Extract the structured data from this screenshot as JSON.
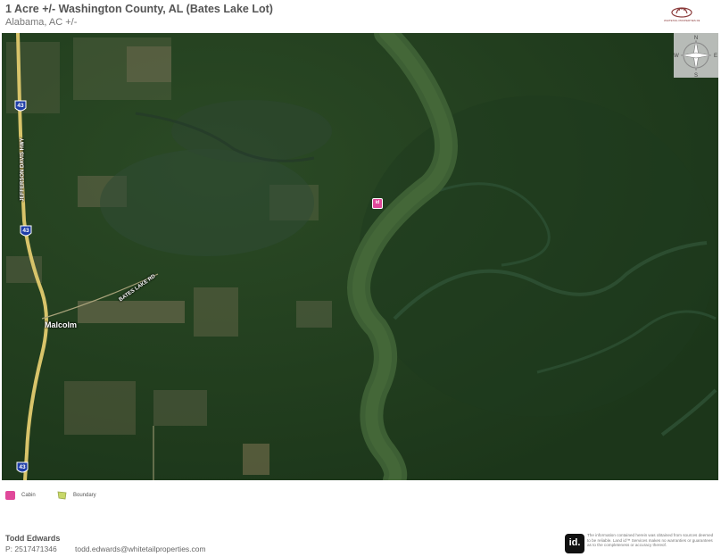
{
  "header": {
    "title": "1 Acre +/- Washington County, AL (Bates Lake Lot)",
    "subtitle": "Alabama,  AC +/-",
    "brand_logo_text": "WHITETAIL PROPERTIES REAL ESTATE"
  },
  "map": {
    "imagery": "satellite",
    "labels": {
      "town": "Malcolm",
      "road_1": "JEFFERSON DAVIS HWY",
      "road_2": "BATES LAKE RD"
    },
    "route_shields": [
      "43",
      "43",
      "43"
    ],
    "marker": {
      "text": "id",
      "label": "Cabin",
      "icon": "cabin-icon",
      "color": "#e0499a"
    },
    "compass": {
      "north": "N",
      "south": "S",
      "east": "E",
      "west": "W"
    },
    "colors": {
      "forest": "#1f3d1c",
      "river": "#3d5f34",
      "highway": "#d8c46a"
    }
  },
  "legend": {
    "items": [
      {
        "label": "Cabin",
        "icon": "cabin-icon",
        "color": "#e0499a"
      },
      {
        "label": "Boundary",
        "icon": "boundary-icon",
        "color": "#c8d86a"
      }
    ]
  },
  "contact": {
    "name": "Todd Edwards",
    "phone": "P: 2517471346",
    "email": "todd.edwards@whitetailproperties.com"
  },
  "footer": {
    "id_logo": "id.",
    "disclaimer": "The information contained herein was obtained from sources deemed to be reliable. Land id™ Services makes no warranties or guarantees as to the completeness or accuracy thereof."
  }
}
